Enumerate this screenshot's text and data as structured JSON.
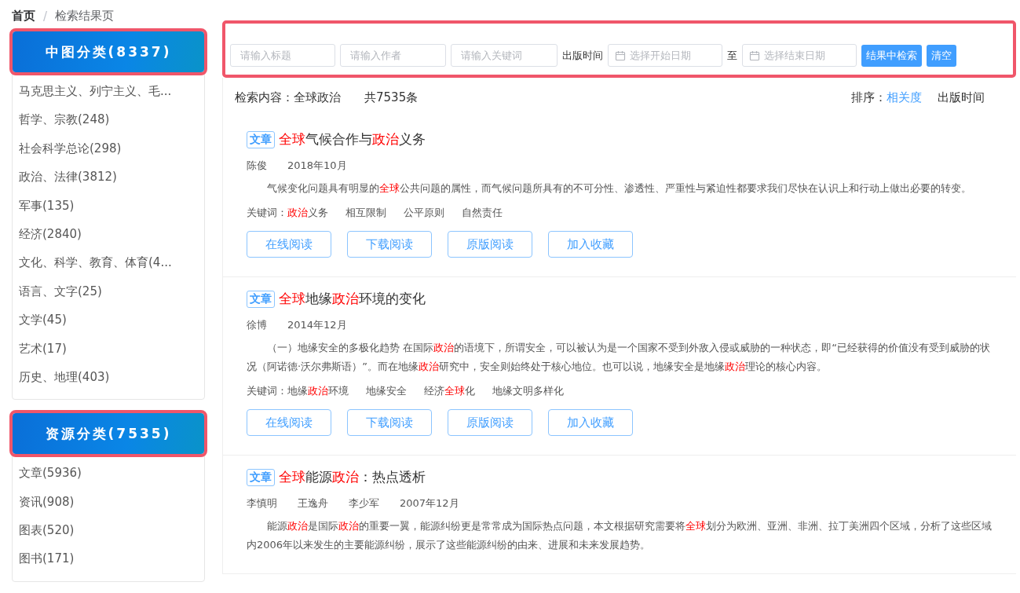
{
  "breadcrumb_separator": "/",
  "breadcrumb": [
    {
      "label": "首页",
      "current": false
    },
    {
      "label": "检索结果页",
      "current": true
    }
  ],
  "sidebar": [
    {
      "title": "中图分类(8337)",
      "highlighted": true,
      "items": [
        "马克思主义、列宁主义、毛...",
        "哲学、宗教(248)",
        "社会科学总论(298)",
        "政治、法律(3812)",
        "军事(135)",
        "经济(2840)",
        "文化、科学、教育、体育(4...",
        "语言、文字(25)",
        "文学(45)",
        "艺术(17)",
        "历史、地理(403)"
      ]
    },
    {
      "title": "资源分类(7535)",
      "highlighted": true,
      "items": [
        "文章(5936)",
        "资讯(908)",
        "图表(520)",
        "图书(171)"
      ]
    }
  ],
  "search_bar": {
    "highlighted": true,
    "title_placeholder": "请输入标题",
    "author_placeholder": "请输入作者",
    "keyword_placeholder": "请输入关键词",
    "date_label": "出版时间",
    "start_placeholder": "选择开始日期",
    "range_separator": "至",
    "end_placeholder": "选择结束日期",
    "buttons": [
      "结果中检索",
      "清空"
    ]
  },
  "summary": {
    "query": "检索内容：全球政治",
    "total": "共7535条",
    "sort_label": "排序：",
    "sort_options": [
      {
        "label": "相关度",
        "selected": true
      },
      {
        "label": "出版时间",
        "selected": false
      }
    ]
  },
  "results": [
    {
      "type": "文章",
      "title": [
        {
          "text": "全球",
          "hit": true
        },
        {
          "text": "气候合作与",
          "hit": false
        },
        {
          "text": "政治",
          "hit": true
        },
        {
          "text": "义务",
          "hit": false
        }
      ],
      "meta": [
        "陈俊",
        "2018年10月"
      ],
      "abstract": [
        {
          "text": "气候变化问题具有明显的",
          "hit": false
        },
        {
          "text": "全球",
          "hit": true
        },
        {
          "text": "公共问题的属性，而气候问题所具有的不可分性、渗透性、严重性与紧迫性都要求我们尽快在认识上和行动上做出必要的转变。",
          "hit": false
        }
      ],
      "keywords_label": "关键词：",
      "keywords": [
        [
          {
            "text": "政治",
            "hit": true
          },
          {
            "text": "义务",
            "hit": false
          }
        ],
        [
          {
            "text": "相互限制",
            "hit": false
          }
        ],
        [
          {
            "text": "公平原则",
            "hit": false
          }
        ],
        [
          {
            "text": "自然责任",
            "hit": false
          }
        ]
      ],
      "actions": [
        "在线阅读",
        "下载阅读",
        "原版阅读",
        "加入收藏"
      ]
    },
    {
      "type": "文章",
      "title": [
        {
          "text": "全球",
          "hit": true
        },
        {
          "text": "地缘",
          "hit": false
        },
        {
          "text": "政治",
          "hit": true
        },
        {
          "text": "环境的变化",
          "hit": false
        }
      ],
      "meta": [
        "徐博",
        "2014年12月"
      ],
      "abstract": [
        {
          "text": "（一）地缘安全的多极化趋势 在国际",
          "hit": false
        },
        {
          "text": "政治",
          "hit": true
        },
        {
          "text": "的语境下，所谓安全，可以被认为是一个国家不受到外敌入侵或威胁的一种状态，即“已经获得的价值没有受到威胁的状况（阿诺德·沃尔弗斯语）”。而在地缘",
          "hit": false
        },
        {
          "text": "政治",
          "hit": true
        },
        {
          "text": "研究中，安全则始终处于核心地位。也可以说，地缘安全是地缘",
          "hit": false
        },
        {
          "text": "政治",
          "hit": true
        },
        {
          "text": "理论的核心内容。",
          "hit": false
        }
      ],
      "keywords_label": "关键词：",
      "keywords": [
        [
          {
            "text": "地缘",
            "hit": false
          },
          {
            "text": "政治",
            "hit": true
          },
          {
            "text": "环境",
            "hit": false
          }
        ],
        [
          {
            "text": "地缘安全",
            "hit": false
          }
        ],
        [
          {
            "text": "经济",
            "hit": false
          },
          {
            "text": "全球",
            "hit": true
          },
          {
            "text": "化",
            "hit": false
          }
        ],
        [
          {
            "text": "地缘文明多样化",
            "hit": false
          }
        ]
      ],
      "actions": [
        "在线阅读",
        "下载阅读",
        "原版阅读",
        "加入收藏"
      ]
    },
    {
      "type": "文章",
      "title": [
        {
          "text": "全球",
          "hit": true
        },
        {
          "text": "能源",
          "hit": false
        },
        {
          "text": "政治",
          "hit": true
        },
        {
          "text": "：热点透析",
          "hit": false
        }
      ],
      "meta": [
        "李慎明",
        "王逸舟",
        "李少军",
        "2007年12月"
      ],
      "abstract": [
        {
          "text": "能源",
          "hit": false
        },
        {
          "text": "政治",
          "hit": true
        },
        {
          "text": "是国际",
          "hit": false
        },
        {
          "text": "政治",
          "hit": true
        },
        {
          "text": "的重要一翼，能源纠纷更是常常成为国际热点问题，本文根据研究需要将",
          "hit": false
        },
        {
          "text": "全球",
          "hit": true
        },
        {
          "text": "划分为欧洲、亚洲、非洲、拉丁美洲四个区域，分析了这些区域内2006年以来发生的主要能源纠纷，展示了这些能源纠纷的由来、进展和未来发展趋势。",
          "hit": false
        }
      ]
    }
  ]
}
